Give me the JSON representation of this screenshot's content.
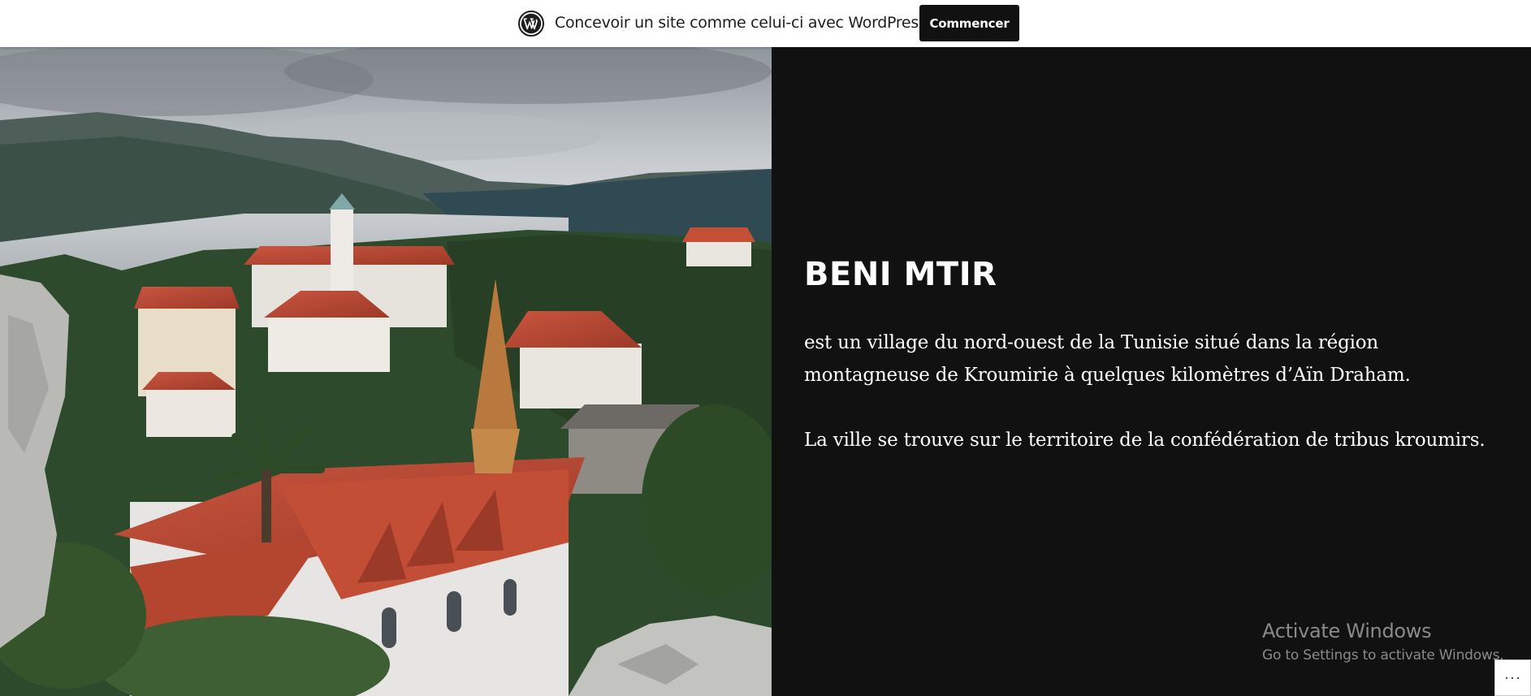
{
  "banner": {
    "logo_icon": "wordpress-logo-icon",
    "text": "Concevoir un site comme celui-ci avec WordPress.com",
    "button_label": "Commencer"
  },
  "hero_image": {
    "icon": "village-landscape-photo"
  },
  "post": {
    "title": "BENI MTIR",
    "paragraph_1": "est un village du nord-ouest de la Tunisie situé dans la région montagneuse de Kroumirie à quelques kilomètres d’Aïn Draham.",
    "paragraph_2": "La ville se trouve sur le territoire de la confédération de tribus kroumirs."
  },
  "watermark": {
    "line_1": "Activate Windows",
    "line_2": "Go to Settings to activate Windows."
  },
  "actions_button": {
    "label": "···",
    "icon": "ellipsis-icon"
  },
  "colors": {
    "background": "#111111",
    "banner_background": "#ffffff",
    "text": "#ffffff"
  }
}
